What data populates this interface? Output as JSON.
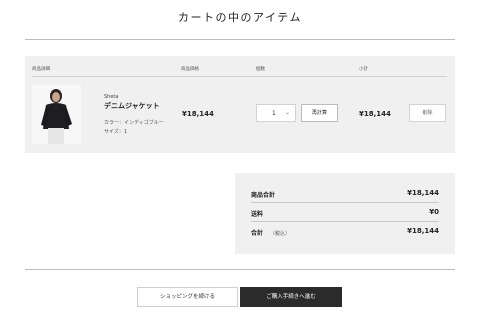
{
  "page": {
    "title": "カートの中のアイテム"
  },
  "cart": {
    "columns": {
      "product": "商品詳細",
      "price": "商品価格",
      "quantity": "個数",
      "subtotal": "小計"
    },
    "item": {
      "brand": "Sheta",
      "name": "デニムジャケット",
      "color": "カラー：インディゴブルー",
      "size": "サイズ：1",
      "price": "¥18,144",
      "quantity": "1",
      "recalc_label": "再計算",
      "subtotal": "¥18,144",
      "remove_label": "削除"
    }
  },
  "summary": {
    "items_label": "商品合計",
    "items_value": "¥18,144",
    "shipping_label": "送料",
    "shipping_value": "¥0",
    "total_label": "合計",
    "total_note": "（税込）",
    "total_value": "¥18,144"
  },
  "actions": {
    "continue_label": "ショッピングを続ける",
    "checkout_label": "ご購入手続きへ進む"
  }
}
